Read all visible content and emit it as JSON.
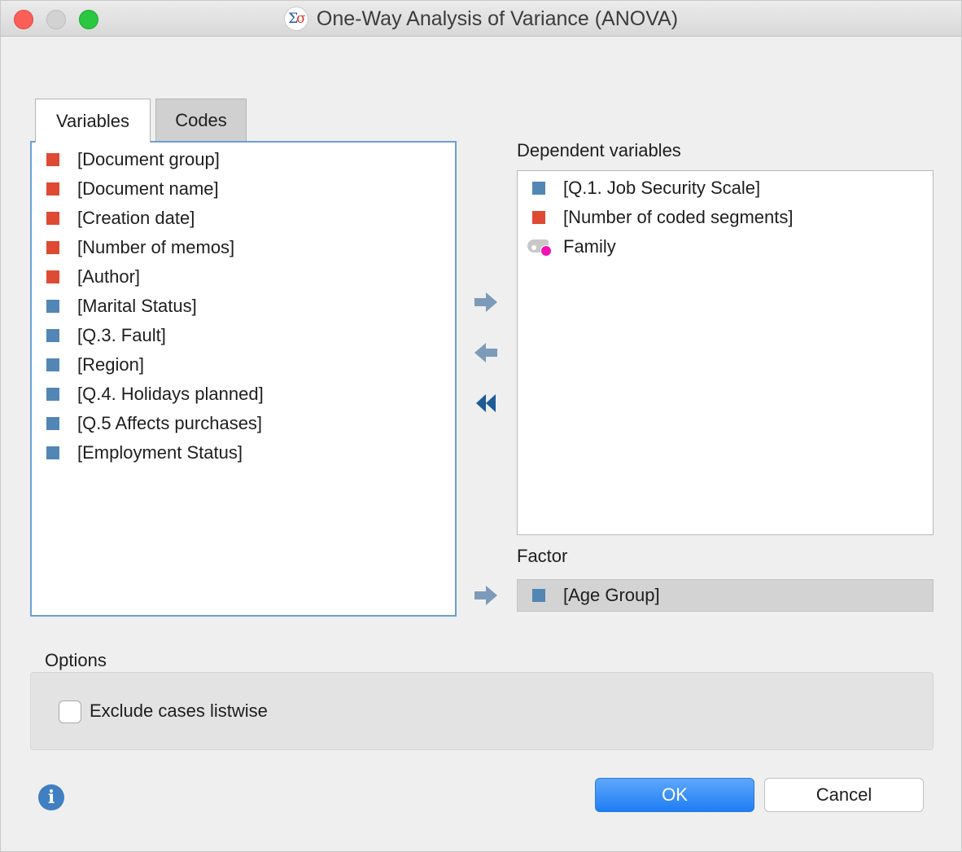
{
  "window": {
    "title": "One-Way Analysis of Variance (ANOVA)",
    "app_icon": "sigma-sigma-app-icon",
    "app_icon_glyphs": [
      "Σ",
      "σ"
    ]
  },
  "tabs": [
    {
      "label": "Variables",
      "active": true
    },
    {
      "label": "Codes",
      "active": false
    }
  ],
  "variables": [
    {
      "label": "[Document group]",
      "color": "#de4a34"
    },
    {
      "label": "[Document name]",
      "color": "#de4a34"
    },
    {
      "label": "[Creation date]",
      "color": "#de4a34"
    },
    {
      "label": "[Number of memos]",
      "color": "#de4a34"
    },
    {
      "label": "[Author]",
      "color": "#de4a34"
    },
    {
      "label": "[Marital Status]",
      "color": "#5286b4"
    },
    {
      "label": "[Q.3. Fault]",
      "color": "#5286b4"
    },
    {
      "label": "[Region]",
      "color": "#5286b4"
    },
    {
      "label": "[Q.4. Holidays planned]",
      "color": "#5286b4"
    },
    {
      "label": "[Q.5 Affects purchases]",
      "color": "#5286b4"
    },
    {
      "label": "[Employment Status]",
      "color": "#5286b4"
    }
  ],
  "dependent": {
    "label": "Dependent variables",
    "items": [
      {
        "label": "[Q.1. Job Security Scale]",
        "icon": "blue-square"
      },
      {
        "label": "[Number of coded segments]",
        "icon": "red-square"
      },
      {
        "label": "Family",
        "icon": "code-tag-magenta-icon"
      }
    ]
  },
  "factor": {
    "label": "Factor",
    "value": "[Age Group]"
  },
  "options": {
    "label": "Options",
    "exclude_label": "Exclude cases listwise",
    "exclude_checked": false
  },
  "buttons": {
    "ok": "OK",
    "cancel": "Cancel"
  },
  "colors": {
    "red": "#de4a34",
    "blue": "#5286b4",
    "accent": "#1f7df3",
    "arrow": "#7d9bb8",
    "arrow_dark": "#1f5b96"
  }
}
